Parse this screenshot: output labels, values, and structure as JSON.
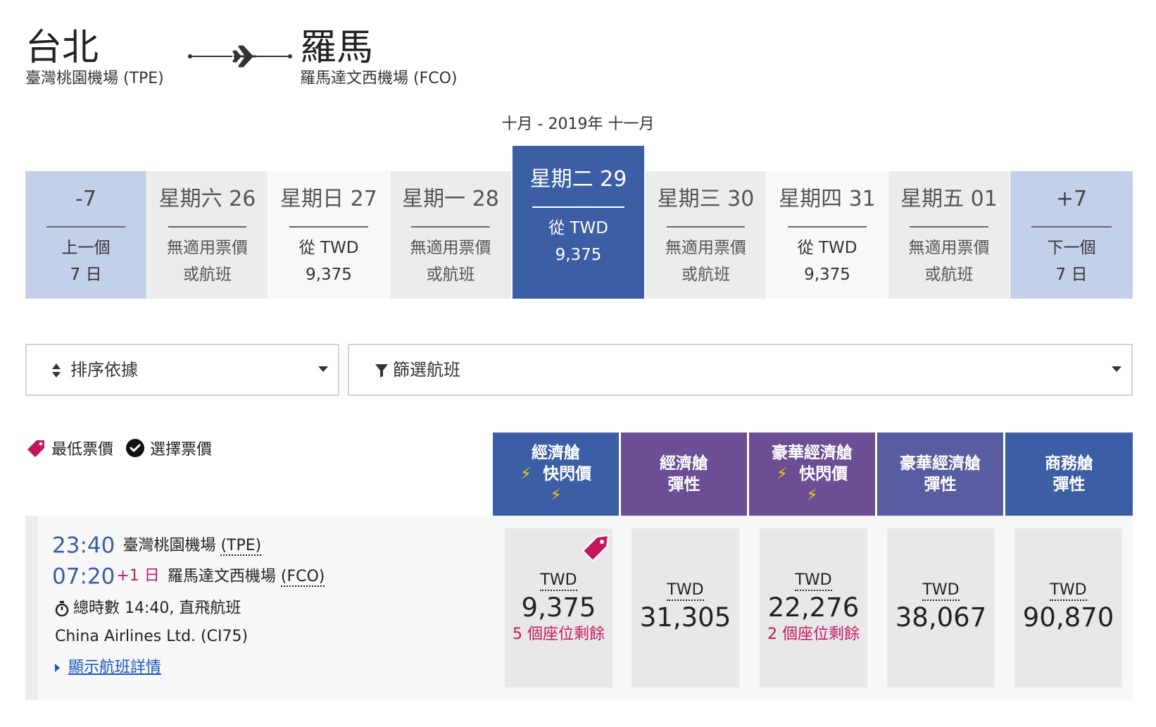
{
  "route": {
    "from_city": "台北",
    "from_airport": "臺灣桃園機場 (TPE)",
    "to_city": "羅馬",
    "to_airport": "羅馬達文西機場 (FCO)"
  },
  "month_range": "十月 - 2019年 十一月",
  "date_strip": {
    "prev": {
      "top": "-7",
      "l1": "上一個",
      "l2": "7 日"
    },
    "days": [
      {
        "label": "星期六 26",
        "l1": "無適用票價",
        "l2": "或航班"
      },
      {
        "label": "星期日 27",
        "l1": "從 TWD",
        "l2": "9,375"
      },
      {
        "label": "星期一 28",
        "l1": "無適用票價",
        "l2": "或航班"
      },
      {
        "label": "星期二 29",
        "l1": "從 TWD",
        "l2": "9,375"
      },
      {
        "label": "星期三 30",
        "l1": "無適用票價",
        "l2": "或航班"
      },
      {
        "label": "星期四 31",
        "l1": "從 TWD",
        "l2": "9,375"
      },
      {
        "label": "星期五 01",
        "l1": "無適用票價",
        "l2": "或航班"
      }
    ],
    "next": {
      "top": "+7",
      "l1": "下一個",
      "l2": "7 日"
    }
  },
  "controls": {
    "sort_label": "排序依據",
    "filter_label": "篩選航班"
  },
  "legend": {
    "lowest": "最低票價",
    "selected": "選擇票價"
  },
  "fare_headers": [
    {
      "l1": "經濟艙",
      "l2": "快閃價",
      "bolts": true
    },
    {
      "l1": "經濟艙",
      "l2": "彈性",
      "bolts": false
    },
    {
      "l1": "豪華經濟艙",
      "l2": "快閃價",
      "bolts": true
    },
    {
      "l1": "豪華經濟艙",
      "l2": "彈性",
      "bolts": false
    },
    {
      "l1": "商務艙",
      "l2": "彈性",
      "bolts": false
    }
  ],
  "bolt_glyph": "⚡",
  "flight": {
    "depart_time": "23:40",
    "depart_airport": "臺灣桃園機場",
    "depart_code": "(TPE)",
    "arrive_time": "07:20",
    "plus_day": "+1 日",
    "arrive_airport": "羅馬達文西機場",
    "arrive_code": "(FCO)",
    "duration": "總時數 14:40, 直飛航班",
    "carrier": "China Airlines Ltd. (CI75)",
    "details_link": "顯示航班詳情"
  },
  "fares": [
    {
      "currency": "TWD",
      "amount": "9,375",
      "seats": "5 個座位剩餘",
      "lowest": true
    },
    {
      "currency": "TWD",
      "amount": "31,305",
      "seats": "",
      "lowest": false
    },
    {
      "currency": "TWD",
      "amount": "22,276",
      "seats": "2 個座位剩餘",
      "lowest": false
    },
    {
      "currency": "TWD",
      "amount": "38,067",
      "seats": "",
      "lowest": false
    },
    {
      "currency": "TWD",
      "amount": "90,870",
      "seats": "",
      "lowest": false
    }
  ],
  "colors": {
    "primary_blue": "#3b5ea4",
    "purple": "#6b4e94",
    "indigo": "#585ca0",
    "nav_light": "#c3d0ea",
    "tag_red": "#c2185b",
    "link_blue": "#1a56c6"
  }
}
